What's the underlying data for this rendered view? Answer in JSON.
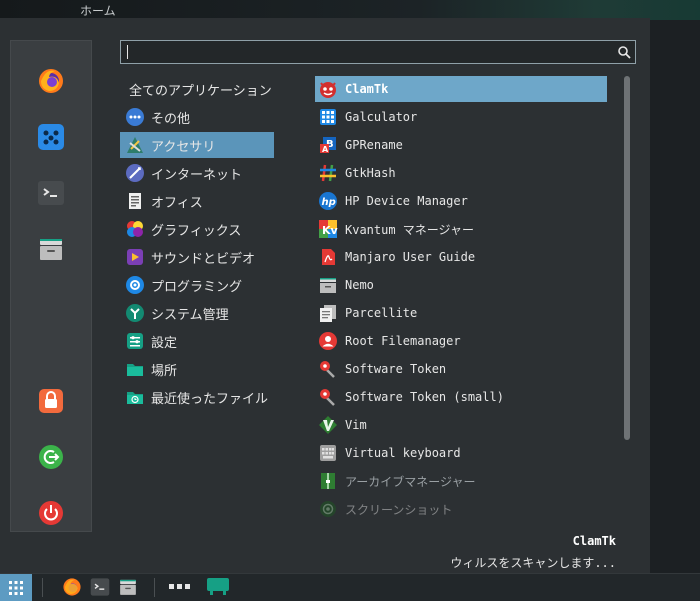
{
  "desktop": {
    "label": "ホーム"
  },
  "search": {
    "value": "",
    "placeholder": ""
  },
  "favorites": [
    {
      "name": "firefox",
      "icon": "firefox-icon"
    },
    {
      "name": "files",
      "icon": "apps-dots-icon"
    },
    {
      "name": "terminal",
      "icon": "terminal-icon"
    },
    {
      "name": "file-manager",
      "icon": "file-cabinet-icon"
    },
    {
      "name": "lock",
      "icon": "lock-icon"
    },
    {
      "name": "logout",
      "icon": "logout-icon"
    },
    {
      "name": "shutdown",
      "icon": "power-icon"
    }
  ],
  "categories": [
    {
      "label": "全てのアプリケーション",
      "icon": ""
    },
    {
      "label": "その他",
      "icon": "other-icon"
    },
    {
      "label": "アクセサリ",
      "icon": "accessories-icon",
      "selected": true
    },
    {
      "label": "インターネット",
      "icon": "internet-icon"
    },
    {
      "label": "オフィス",
      "icon": "office-icon"
    },
    {
      "label": "グラフィックス",
      "icon": "graphics-icon"
    },
    {
      "label": "サウンドとビデオ",
      "icon": "multimedia-icon"
    },
    {
      "label": "プログラミング",
      "icon": "programming-icon"
    },
    {
      "label": "システム管理",
      "icon": "system-icon"
    },
    {
      "label": "設定",
      "icon": "settings-icon"
    },
    {
      "label": "場所",
      "icon": "places-icon"
    },
    {
      "label": "最近使ったファイル",
      "icon": "recent-files-icon"
    }
  ],
  "apps": [
    {
      "label": "ClamTk",
      "icon": "clamtk-icon",
      "selected": true
    },
    {
      "label": "Galculator",
      "icon": "calculator-icon"
    },
    {
      "label": "GPRename",
      "icon": "gprename-icon"
    },
    {
      "label": "GtkHash",
      "icon": "hash-icon"
    },
    {
      "label": "HP Device Manager",
      "icon": "hp-icon"
    },
    {
      "label": "Kvantum マネージャー",
      "icon": "kvantum-icon"
    },
    {
      "label": "Manjaro User Guide",
      "icon": "pdf-icon"
    },
    {
      "label": "Nemo",
      "icon": "nemo-icon"
    },
    {
      "label": "Parcellite",
      "icon": "clipboard-icon"
    },
    {
      "label": "Root Filemanager",
      "icon": "root-user-icon"
    },
    {
      "label": "Software Token",
      "icon": "token-icon"
    },
    {
      "label": "Software Token (small)",
      "icon": "token-icon"
    },
    {
      "label": "Vim",
      "icon": "vim-icon"
    },
    {
      "label": "Virtual keyboard",
      "icon": "keyboard-icon"
    },
    {
      "label": "アーカイブマネージャー",
      "icon": "archive-icon",
      "dim": true
    },
    {
      "label": "スクリーンショット",
      "icon": "screenshot-icon",
      "dimmer": true
    }
  ],
  "description": {
    "title": "ClamTk",
    "text": "ウィルスをスキャンします..."
  },
  "taskbar": {
    "items": [
      "menu-grid-icon",
      "firefox-icon",
      "terminal-icon",
      "file-cabinet-icon",
      "workspaces-icon",
      "window-icon"
    ]
  }
}
